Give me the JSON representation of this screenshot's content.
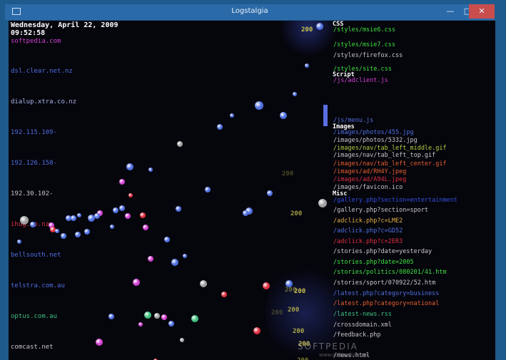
{
  "window": {
    "title": "Logstalgia",
    "minimize_label": "—",
    "maximize_label": "□",
    "close_label": "✕"
  },
  "clock": {
    "date": "Wednesday, April 22, 2009",
    "time": "09:52:58"
  },
  "hosts": [
    {
      "label": "softpedia.com",
      "color": "#d040d0"
    },
    {
      "label": "dsl.clear.net.nz",
      "color": "#5070e0"
    },
    {
      "label": "dialup.xtra.co.nz",
      "color": "#a8b4e6"
    },
    {
      "label": "192.115.109-",
      "color": "#5070e0"
    },
    {
      "label": "192.126.158-",
      "color": "#5070e0"
    },
    {
      "label": "192.30.102-",
      "color": "#c8c8c8"
    },
    {
      "label": "ihug.co.nz",
      "color": "#e03040"
    },
    {
      "label": "bellsouth.net",
      "color": "#5070e0"
    },
    {
      "label": "telstra.com.au",
      "color": "#5070e0"
    },
    {
      "label": "optus.com.au",
      "color": "#40c080"
    },
    {
      "label": "comcast.net",
      "color": "#c8c8c8"
    }
  ],
  "groups": {
    "css": "CSS",
    "script": "Script",
    "images": "Images",
    "misc": "Misc"
  },
  "paths": [
    {
      "label": "/styles/msie6.css",
      "color": "#40e040"
    },
    {
      "label": "/styles/msie7.css",
      "color": "#40e040"
    },
    {
      "label": "/styles/firefox.css",
      "color": "#c8c8c8"
    },
    {
      "label": "/styles/site.css",
      "color": "#40e040"
    },
    {
      "label": "/js/adclient.js",
      "color": "#d040d0"
    },
    {
      "label": "/js/menu.js",
      "color": "#5070e0"
    },
    {
      "label": "/images/photos/455.jpg",
      "color": "#5070e0"
    },
    {
      "label": "/images/photos/5332.jpg",
      "color": "#c8c8c8"
    },
    {
      "label": "/images/nav/tab_left_middle.gif",
      "color": "#b0d040"
    },
    {
      "label": "/images/nav/tab_left_top.gif",
      "color": "#c8c8c8"
    },
    {
      "label": "/images/nav/tab_left_center.gif",
      "color": "#e86030"
    },
    {
      "label": "/images/ad/RH4Y.jpeg",
      "color": "#e86030"
    },
    {
      "label": "/images/ad/A94L.jpeg",
      "color": "#e03040"
    },
    {
      "label": "/images/favicon.ico",
      "color": "#c8c8c8"
    },
    {
      "label": "/gallery.php?section=entertainment",
      "color": "#3050e0"
    },
    {
      "label": "/gallery.php?section=sport",
      "color": "#c8c8c8"
    },
    {
      "label": "/adclick.php?c=LME2",
      "color": "#e0b040"
    },
    {
      "label": "/adclick.php?c=GD52",
      "color": "#5070e0"
    },
    {
      "label": "/adclick.php?c=2ER3",
      "color": "#e03040"
    },
    {
      "label": "/stories.php?date=yesterday",
      "color": "#c8c8c8"
    },
    {
      "label": "/stories.php?date=2005",
      "color": "#40e040"
    },
    {
      "label": "/stories/politics/080201/41.htm",
      "color": "#40e040"
    },
    {
      "label": "/stories/sport/070922/52.htm",
      "color": "#c8c8c8"
    },
    {
      "label": "/latest.php?category=business",
      "color": "#5070e0"
    },
    {
      "label": "/latest.php?category=national",
      "color": "#e86030"
    },
    {
      "label": "/latest-news.rss",
      "color": "#40c080"
    },
    {
      "label": "/crossdomain.xml",
      "color": "#c8c8c8"
    },
    {
      "label": "/feedback.php",
      "color": "#c8c8c8"
    },
    {
      "label": "/news.html",
      "color": "#c8c8c8"
    }
  ],
  "response_codes": [
    "200",
    "200",
    "200",
    "200",
    "200",
    "200",
    "200",
    "200",
    "200",
    "200"
  ],
  "colors": {
    "background": "#05050c",
    "paddle": "#5a6ee0",
    "code_text": "#c8c050"
  },
  "watermark": {
    "text": "SOFTPEDIA",
    "sub": "www.softpedia.com"
  }
}
